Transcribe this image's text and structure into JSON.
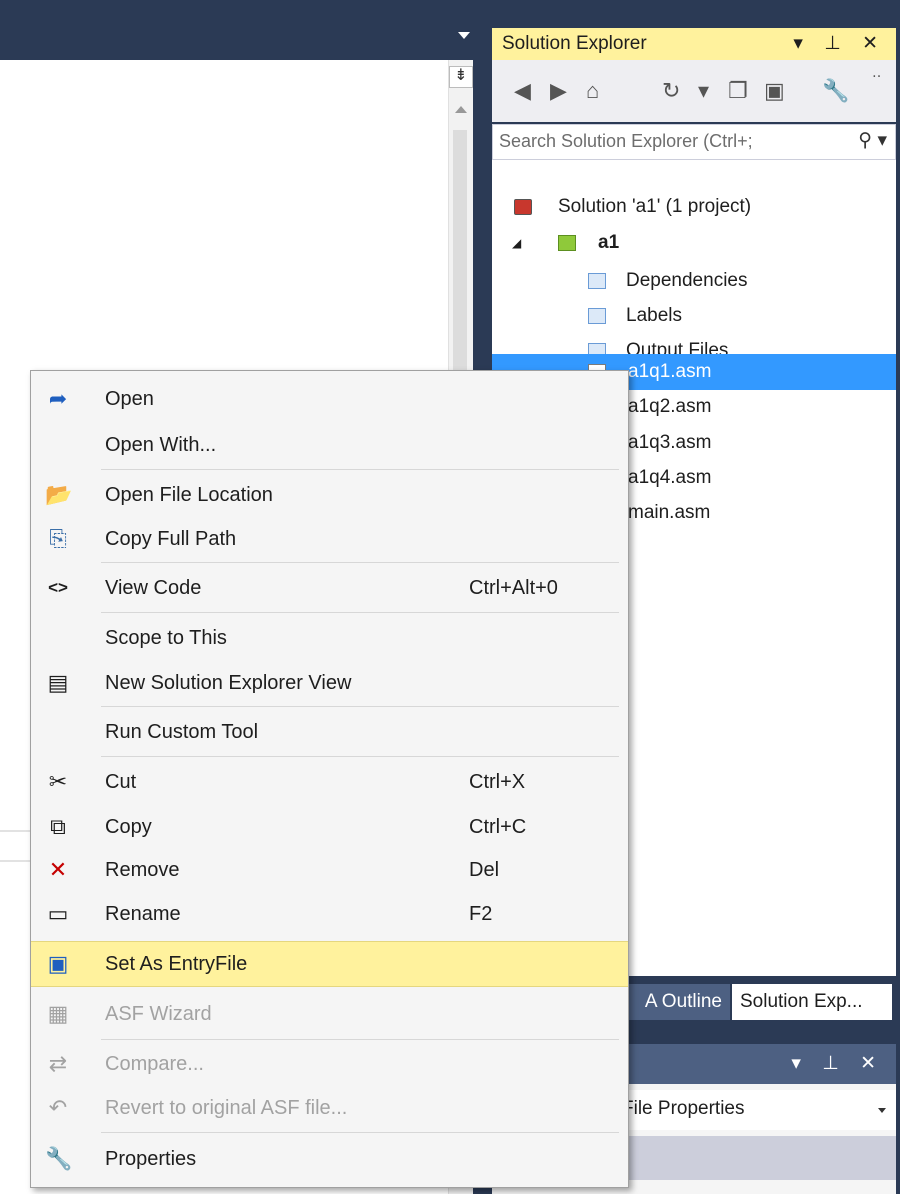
{
  "editor": {
    "split_glyph": "⇟"
  },
  "solution_explorer": {
    "title": "Solution Explorer",
    "title_controls": "▾ ⊥ ✕",
    "toolbar_icons": [
      "back-icon",
      "forward-icon",
      "home-icon",
      "history-icon",
      "dropdown-icon",
      "sync-icon",
      "collapse-icon",
      "properties-icon"
    ],
    "toolbar_glyphs": [
      "◀",
      "▶",
      "⌂",
      "↻",
      "▾",
      "❐",
      "▣",
      "🔧",
      "‥"
    ],
    "search_placeholder": "Search Solution Explorer (Ctrl+;",
    "search_glyph": "⚲ ▾",
    "tree": {
      "solution_label": "Solution 'a1' (1 project)",
      "project_label": "a1",
      "expand_glyph": "◢",
      "folders": [
        "Dependencies",
        "Labels",
        "Output Files"
      ],
      "files": [
        "a1q1.asm",
        "a1q2.asm",
        "a1q3.asm",
        "a1q4.asm",
        "main.asm"
      ]
    },
    "tabs": {
      "outline": "A Outline",
      "explorer": "Solution Exp..."
    }
  },
  "properties": {
    "title_controls": "▾ ⊥ ✕",
    "combo_text": "File Properties"
  },
  "context_menu": {
    "items": [
      {
        "label": "Open",
        "shortcut": "",
        "icon": "open-arrow-icon",
        "glyph": "➦"
      },
      {
        "label": "Open With...",
        "shortcut": "",
        "icon": "",
        "glyph": ""
      },
      {
        "label": "Open File Location",
        "shortcut": "",
        "icon": "folder-open-icon",
        "glyph": "📂"
      },
      {
        "label": "Copy Full Path",
        "shortcut": "",
        "icon": "copy-path-icon",
        "glyph": "⎘"
      },
      {
        "label": "View Code",
        "shortcut": "Ctrl+Alt+0",
        "icon": "code-icon",
        "glyph": "<>"
      },
      {
        "label": "Scope to This",
        "shortcut": "",
        "icon": "",
        "glyph": ""
      },
      {
        "label": "New Solution Explorer View",
        "shortcut": "",
        "icon": "new-view-icon",
        "glyph": "▤"
      },
      {
        "label": "Run Custom Tool",
        "shortcut": "",
        "icon": "",
        "glyph": ""
      },
      {
        "label": "Cut",
        "shortcut": "Ctrl+X",
        "icon": "scissors-icon",
        "glyph": "✂"
      },
      {
        "label": "Copy",
        "shortcut": "Ctrl+C",
        "icon": "copy-icon",
        "glyph": "⧉"
      },
      {
        "label": "Remove",
        "shortcut": "Del",
        "icon": "remove-x-icon",
        "glyph": "✕"
      },
      {
        "label": "Rename",
        "shortcut": "F2",
        "icon": "rename-icon",
        "glyph": "▭"
      },
      {
        "label": "Set As EntryFile",
        "shortcut": "",
        "icon": "entry-file-icon",
        "glyph": "▣"
      },
      {
        "label": "ASF Wizard",
        "shortcut": "",
        "icon": "wizard-icon",
        "glyph": "▦"
      },
      {
        "label": "Compare...",
        "shortcut": "",
        "icon": "compare-icon",
        "glyph": "⇄"
      },
      {
        "label": "Revert to original ASF file...",
        "shortcut": "",
        "icon": "revert-icon",
        "glyph": "↶"
      },
      {
        "label": "Properties",
        "shortcut": "",
        "icon": "wrench-icon",
        "glyph": "🔧"
      }
    ],
    "remove_icon_color": "#c50000",
    "entry_icon_color": "#1f5fbf"
  }
}
